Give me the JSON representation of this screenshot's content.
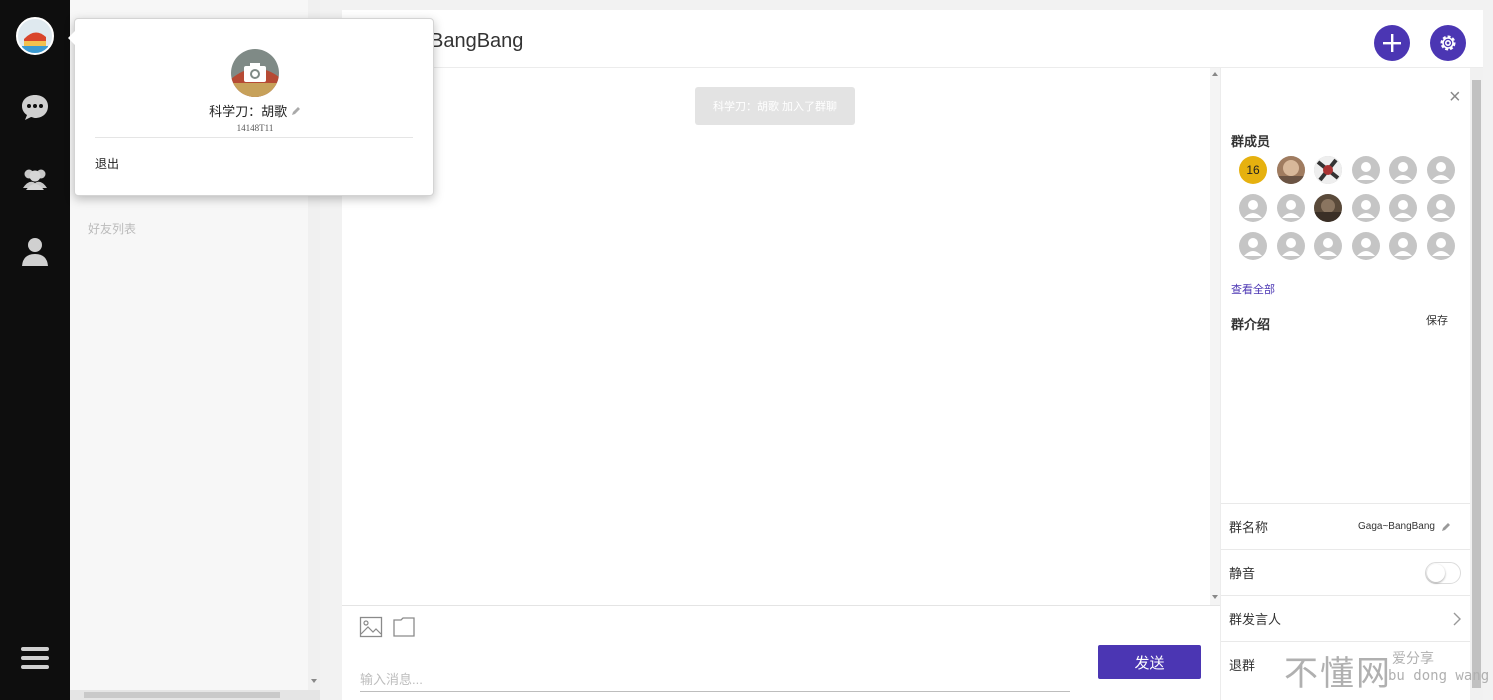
{
  "popup": {
    "name": "科学刀：胡歌",
    "id": "14148T11",
    "logout_label": "退出"
  },
  "contacts": {
    "friends_title": "好友列表"
  },
  "chat": {
    "title": "BangBang",
    "system_message": "科学刀：胡歌 加入了群聊",
    "input_placeholder": "输入消息...",
    "send_label": "发送"
  },
  "side": {
    "close": "×",
    "members_title": "群成员",
    "member_count": "16",
    "view_all": "查看全部",
    "intro_title": "群介绍",
    "save_label": "保存",
    "group_name_label": "群名称",
    "group_name_value": "Gaga~BangBang",
    "mute_label": "静音",
    "mute_on": false,
    "speakers_label": "群发言人",
    "leave_label": "退群"
  },
  "watermark": {
    "big": "不懂网",
    "line1": "爱分享",
    "line2": "bu dong wang"
  },
  "icons": [
    "chat-icon",
    "group-icon",
    "person-icon",
    "menu-icon",
    "plus-icon",
    "gear-icon",
    "image-icon",
    "folder-icon",
    "camera-icon",
    "edit-icon",
    "chevron-right-icon",
    "close-icon"
  ],
  "colors": {
    "accent": "#4b36b3",
    "count_badge": "#e6b10f",
    "nav_bg": "#0e0e0e"
  }
}
